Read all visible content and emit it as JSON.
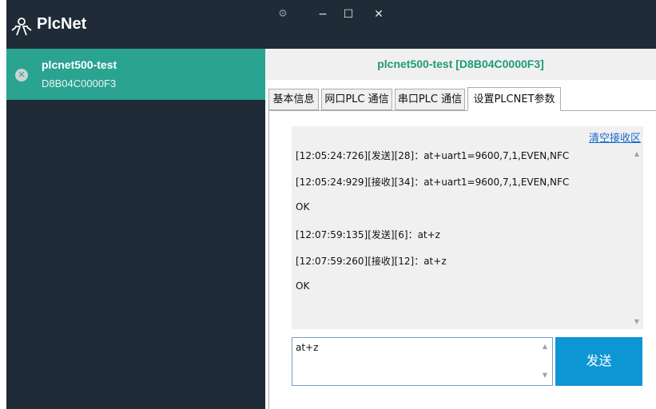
{
  "app": {
    "title": "PlcNet",
    "window_buttons": {
      "settings": "⚙",
      "minimize": "−",
      "maximize": "☐",
      "close": "✕"
    }
  },
  "device": {
    "name": "plcnet500-test",
    "mac": "D8B04C0000F3",
    "remove_icon": "✕",
    "header_title": "plcnet500-test  [D8B04C0000F3]"
  },
  "tabs": [
    {
      "label": "基本信息"
    },
    {
      "label": "网口PLC 通信"
    },
    {
      "label": "串口PLC 通信"
    },
    {
      "label": "设置PLCNET参数"
    }
  ],
  "active_tab": 3,
  "receive": {
    "clear_label": "清空接收区",
    "lines": [
      "[12:05:24:726][发送][28]：at+uart1=9600,7,1,EVEN,NFC",
      "[12:05:24:929][接收][34]：at+uart1=9600,7,1,EVEN,NFC",
      "OK",
      "[12:07:59:135][发送][6]：at+z",
      "[12:07:59:260][接收][12]：at+z",
      "OK"
    ]
  },
  "send": {
    "input_value": "at+z",
    "button_label": "发送"
  },
  "colors": {
    "sidebar_bg": "#1f2b36",
    "selected_item": "#2aa391",
    "header_title": "#1d9a7a",
    "send_button": "#0d96d4",
    "link": "#1a6cc9"
  },
  "icons": {
    "logo": "plcnet-logo-icon",
    "scroll_up": "▲",
    "scroll_down": "▼"
  }
}
